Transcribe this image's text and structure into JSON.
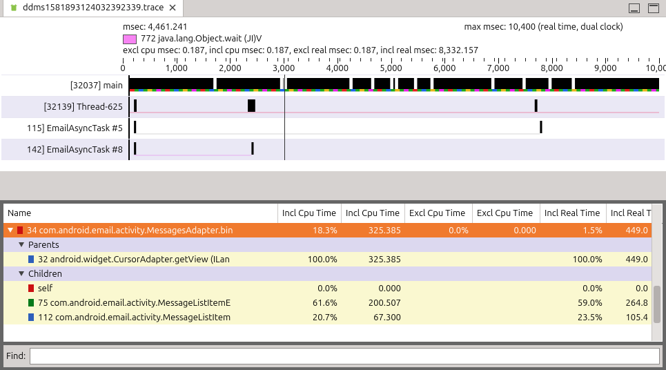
{
  "tab": {
    "title": "ddms1581893124032392339.trace"
  },
  "info": {
    "msec_label": "msec: 4,461.241",
    "maxmsec_label": "max msec: 10,400 (real time, dual clock)",
    "legend_text": "772 java.lang.Object.wait (JI)V",
    "stats": "excl cpu msec: 0.187, incl cpu msec: 0.187, excl real msec: 0.187, incl real msec: 8,332.157"
  },
  "scale": {
    "labels": [
      "0",
      "1,000",
      "2,000",
      "3,000",
      "4,000",
      "5,000",
      "6,000",
      "7,000",
      "8,000",
      "9,000",
      "10,000"
    ]
  },
  "threads": [
    {
      "label": "[32037] main"
    },
    {
      "label": "[32139] Thread-625"
    },
    {
      "label": "115] EmailAsyncTask #5"
    },
    {
      "label": "142] EmailAsyncTask #8"
    }
  ],
  "table": {
    "headers": [
      "Name",
      "Incl Cpu Time",
      "Incl Cpu Time",
      "Excl Cpu Time",
      "Excl Cpu Time",
      "Incl Real Time",
      "Incl Real Ti"
    ],
    "rows": [
      {
        "kind": "sel",
        "square": "#c11",
        "text": "34 com.android.email.activity.MessagesAdapter.bin",
        "c": [
          "18.3%",
          "325.385",
          "0.0%",
          "0.000",
          "1.5%",
          "449.0"
        ]
      },
      {
        "kind": "head",
        "text": "Parents",
        "c": [
          "",
          "",
          "",
          "",
          "",
          ""
        ]
      },
      {
        "kind": "child",
        "square": "#2d5fbb",
        "text": "32 android.widget.CursorAdapter.getView (ILan",
        "c": [
          "100.0%",
          "325.385",
          "",
          "",
          "100.0%",
          "449.0"
        ]
      },
      {
        "kind": "head",
        "text": "Children",
        "c": [
          "",
          "",
          "",
          "",
          "",
          ""
        ]
      },
      {
        "kind": "yellow",
        "square": "#c11",
        "text": "self",
        "indent": 2,
        "c": [
          "0.0%",
          "0.000",
          "",
          "",
          "0.0%",
          "0.0"
        ]
      },
      {
        "kind": "yellow",
        "square": "#067a1a",
        "text": "75 com.android.email.activity.MessageListItemE",
        "indent": 2,
        "c": [
          "61.6%",
          "200.507",
          "",
          "",
          "59.0%",
          "264.8"
        ]
      },
      {
        "kind": "yellow",
        "square": "#2d5fbb",
        "text": "112 com.android.email.activity.MessageListItem",
        "indent": 2,
        "c": [
          "20.7%",
          "67.300",
          "",
          "",
          "23.5%",
          "105.4"
        ]
      }
    ]
  },
  "find": {
    "label": "Find:",
    "value": ""
  },
  "chart_data": {
    "type": "timeline",
    "x_unit": "msec",
    "x_range": [
      0,
      10400
    ],
    "threads": [
      {
        "name": "[32037] main",
        "activity": "dense continuous segments across 0–10400 with small gaps"
      },
      {
        "name": "[32139] Thread-625",
        "events_at_msec": [
          200,
          2350,
          2380,
          8000
        ]
      },
      {
        "name": "115] EmailAsyncTask #5",
        "events_at_msec": [
          200,
          8100
        ]
      },
      {
        "name": "142] EmailAsyncTask #8",
        "events_at_msec": [
          200,
          2420
        ]
      }
    ]
  }
}
